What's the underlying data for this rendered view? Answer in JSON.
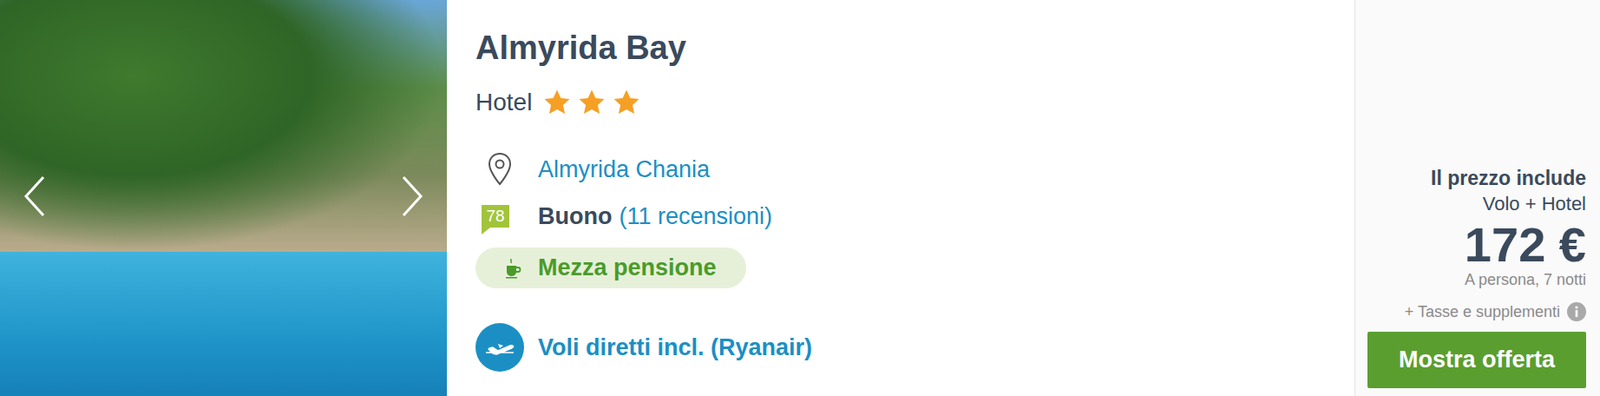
{
  "hotel": {
    "name": "Almyrida Bay",
    "type": "Hotel",
    "stars": 3,
    "location": "Almyrida Chania",
    "rating": {
      "score": "78",
      "label": "Buono",
      "reviews": "(11 recensioni)"
    },
    "board": "Mezza pensione",
    "flights": "Voli diretti incl. (Ryanair)"
  },
  "price": {
    "heading": "Il prezzo include",
    "includes": "Volo + Hotel",
    "amount": "172 €",
    "per": "A persona, 7 notti",
    "extras": "+ Tasse e supplementi",
    "button": "Mostra offerta"
  }
}
